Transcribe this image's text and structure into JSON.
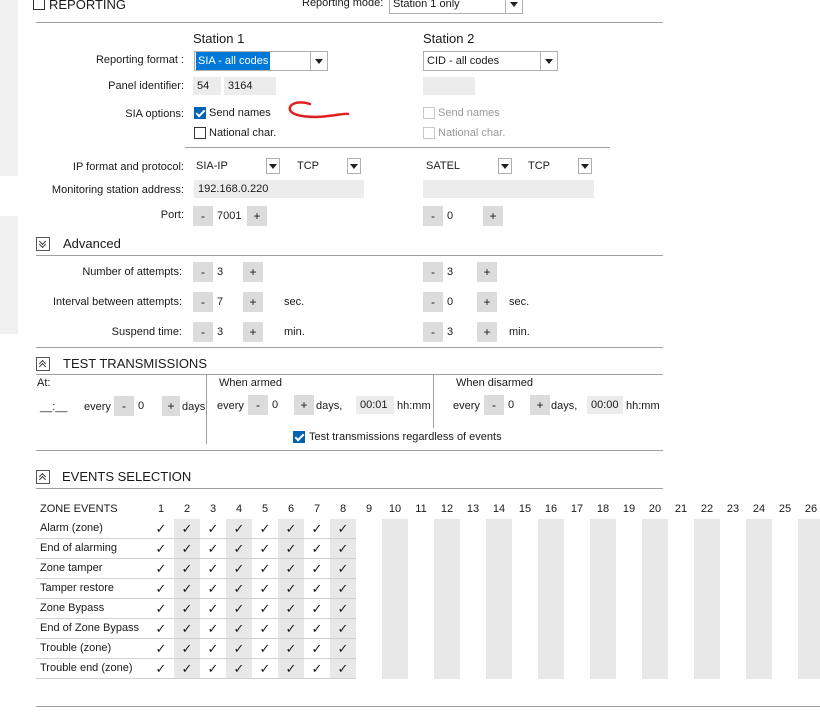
{
  "reporting": {
    "title": "REPORTING",
    "mode_label": "Reporting mode:",
    "mode_value": "Station 1 only"
  },
  "stations": {
    "s1_title": "Station 1",
    "s2_title": "Station 2"
  },
  "labels": {
    "reporting_format": "Reporting format :",
    "panel_identifier": "Panel identifier:",
    "sia_options": "SIA options:",
    "ip_format": "IP format and protocol:",
    "monitoring_address": "Monitoring station address:",
    "port": "Port:"
  },
  "station1": {
    "format": "SIA - all codes",
    "panel_id_1": "54",
    "panel_id_2": "3164",
    "send_names": "Send names",
    "national_char": "National char.",
    "ip_format": "SIA-IP",
    "protocol": "TCP",
    "address": "192.168.0.220",
    "port": "7001",
    "attempts": "3",
    "interval": "7",
    "suspend": "3"
  },
  "station2": {
    "format": "CID - all codes",
    "send_names": "Send names",
    "national_char": "National char.",
    "ip_format": "SATEL",
    "protocol": "TCP",
    "address": "",
    "port": "0",
    "attempts": "3",
    "interval": "0",
    "suspend": "3"
  },
  "advanced": {
    "title": "Advanced",
    "attempts_label": "Number of attempts:",
    "interval_label": "Interval between attempts:",
    "suspend_label": "Suspend time:",
    "sec": "sec.",
    "min": "min."
  },
  "stepper": {
    "minus": "-",
    "plus": "+"
  },
  "test": {
    "title": "TEST TRANSMISSIONS",
    "at_label": "At:",
    "at_value": "__:__",
    "every": "every",
    "days_short": "days",
    "days": "days,",
    "every_value": "0",
    "armed_label": "When armed",
    "armed_every": "0",
    "armed_time": "00:01",
    "disarmed_label": "When disarmed",
    "disarmed_every": "0",
    "disarmed_time": "00:00",
    "hhmm": "hh:mm",
    "regardless": "Test transmissions regardless of events"
  },
  "events": {
    "title": "EVENTS SELECTION",
    "zone_events": "ZONE EVENTS",
    "columns": [
      "1",
      "2",
      "3",
      "4",
      "5",
      "6",
      "7",
      "8",
      "9",
      "10",
      "11",
      "12",
      "13",
      "14",
      "15",
      "16",
      "17",
      "18",
      "19",
      "20",
      "21",
      "22",
      "23",
      "24",
      "25",
      "26"
    ],
    "checkmark": "✓",
    "rows": [
      {
        "name": "Alarm  (zone)",
        "checked": 8
      },
      {
        "name": "End of alarming",
        "checked": 8
      },
      {
        "name": "Zone tamper",
        "checked": 8
      },
      {
        "name": "Tamper restore",
        "checked": 8
      },
      {
        "name": "Zone Bypass",
        "checked": 8
      },
      {
        "name": "End of Zone Bypass",
        "checked": 8
      },
      {
        "name": "Trouble (zone)",
        "checked": 8
      },
      {
        "name": "Trouble end (zone)",
        "checked": 8
      }
    ]
  },
  "colors": {
    "selection": "#0078d7",
    "checkbox": "#0063b1",
    "annotation": "#e02020"
  }
}
